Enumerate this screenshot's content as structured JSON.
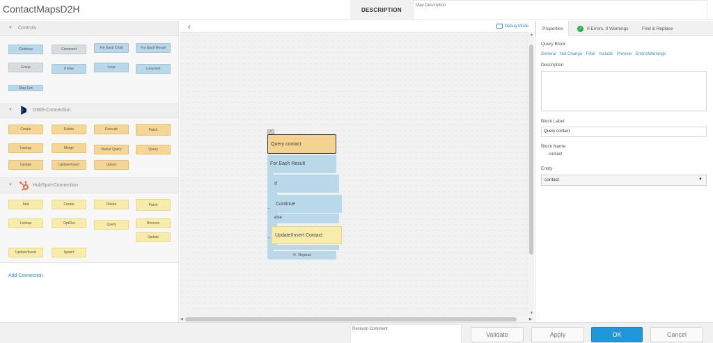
{
  "header": {
    "title": "ContactMapsD2H",
    "description_label": "DESCRIPTION",
    "description_placeholder": "Map Description"
  },
  "palette": {
    "sections": [
      {
        "name": "Controls",
        "blocks": [
          "Continue",
          "Comment",
          "For Each Child",
          "For Each Result",
          "Group",
          "If Else",
          "Loop",
          "Loop Exit",
          "Map Exit"
        ]
      },
      {
        "name": "D365-Connection",
        "logo": "dynamics-logo",
        "blocks": [
          "Create",
          "Delete",
          "Execute",
          "Patch",
          "Lookup",
          "Merge",
          "Native Query",
          "Query",
          "Update",
          "Update/Insert",
          "Upsert"
        ]
      },
      {
        "name": "HubSpot-Connection",
        "logo": "hubspot-logo",
        "blocks": [
          "Add",
          "Create",
          "Delete",
          "Patch",
          "Lookup",
          "OptOut",
          "Query",
          "Remove",
          "Update",
          "Update/Insert",
          "Upsert"
        ]
      }
    ],
    "add_connection": "Add Connection"
  },
  "canvas": {
    "debug_mode": "Debug Mode",
    "flow": {
      "query": "Query contact",
      "for_each": "For Each Result",
      "if": "If",
      "continue": "Continue",
      "else": "else",
      "update_insert": "Update/Insert Contact",
      "repeat": "Repeat"
    }
  },
  "properties": {
    "tabs": [
      "Properties",
      "0 Errors, 0 Warnings",
      "Find & Replace"
    ],
    "block_type": "Query Block",
    "links": [
      "General",
      "Net Change",
      "Filter",
      "Include",
      "Preview",
      "Errors/Warnings"
    ],
    "description_label": "Description",
    "block_label_label": "Block Label",
    "block_label_value": "Query contact",
    "block_name_label": "Block Name:",
    "block_name_value": "contact",
    "entity_label": "Entity",
    "entity_value": "contact"
  },
  "footer": {
    "revision_placeholder": "Revision Comment",
    "validate": "Validate",
    "apply": "Apply",
    "ok": "OK",
    "cancel": "Cancel"
  },
  "colors": {
    "accent": "#2196d8",
    "control_block": "#b9d8ea",
    "d365_block": "#f5d694",
    "hubspot_block": "#f7ecaa",
    "success": "#22b14c"
  }
}
